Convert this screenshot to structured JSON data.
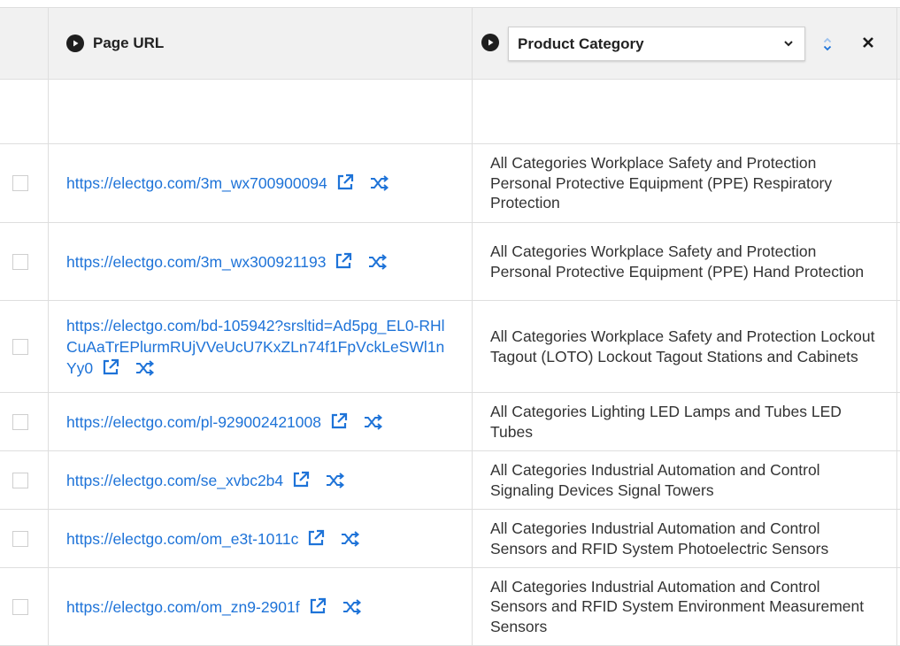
{
  "header": {
    "page_url_label": "Page URL",
    "category_selected": "Product Category"
  },
  "rows": [
    {
      "url": "https://electgo.com/3m_wx700900094",
      "category": "All Categories Workplace Safety and Protection Personal Protective Equipment (PPE) Respiratory Protection"
    },
    {
      "url": "https://electgo.com/3m_wx300921193",
      "category": "All Categories Workplace Safety and Protection Personal Protective Equipment (PPE) Hand Protection"
    },
    {
      "url": "https://electgo.com/bd-105942?srsltid=Ad5pg_EL0-RHlCuAaTrEPlurmRUjVVeUcU7KxZLn74f1FpVckLeSWl1nYy0",
      "category": "All Categories Workplace Safety and Protection Lockout Tagout (LOTO) Lockout Tagout Stations and Cabinets"
    },
    {
      "url": "https://electgo.com/pl-929002421008",
      "category": "All Categories Lighting LED Lamps and Tubes LED Tubes"
    },
    {
      "url": "https://electgo.com/se_xvbc2b4",
      "category": "All Categories Industrial Automation and Control Signaling Devices Signal Towers"
    },
    {
      "url": "https://electgo.com/om_e3t-1011c",
      "category": "All Categories Industrial Automation and Control Sensors and RFID System Photoelectric Sensors"
    },
    {
      "url": "https://electgo.com/om_zn9-2901f",
      "category": "All Categories Industrial Automation and Control Sensors and RFID System Environment Measurement Sensors"
    }
  ],
  "colors": {
    "link": "#1e73d8",
    "header_bg": "#f1f1f1",
    "border": "#dedede"
  }
}
